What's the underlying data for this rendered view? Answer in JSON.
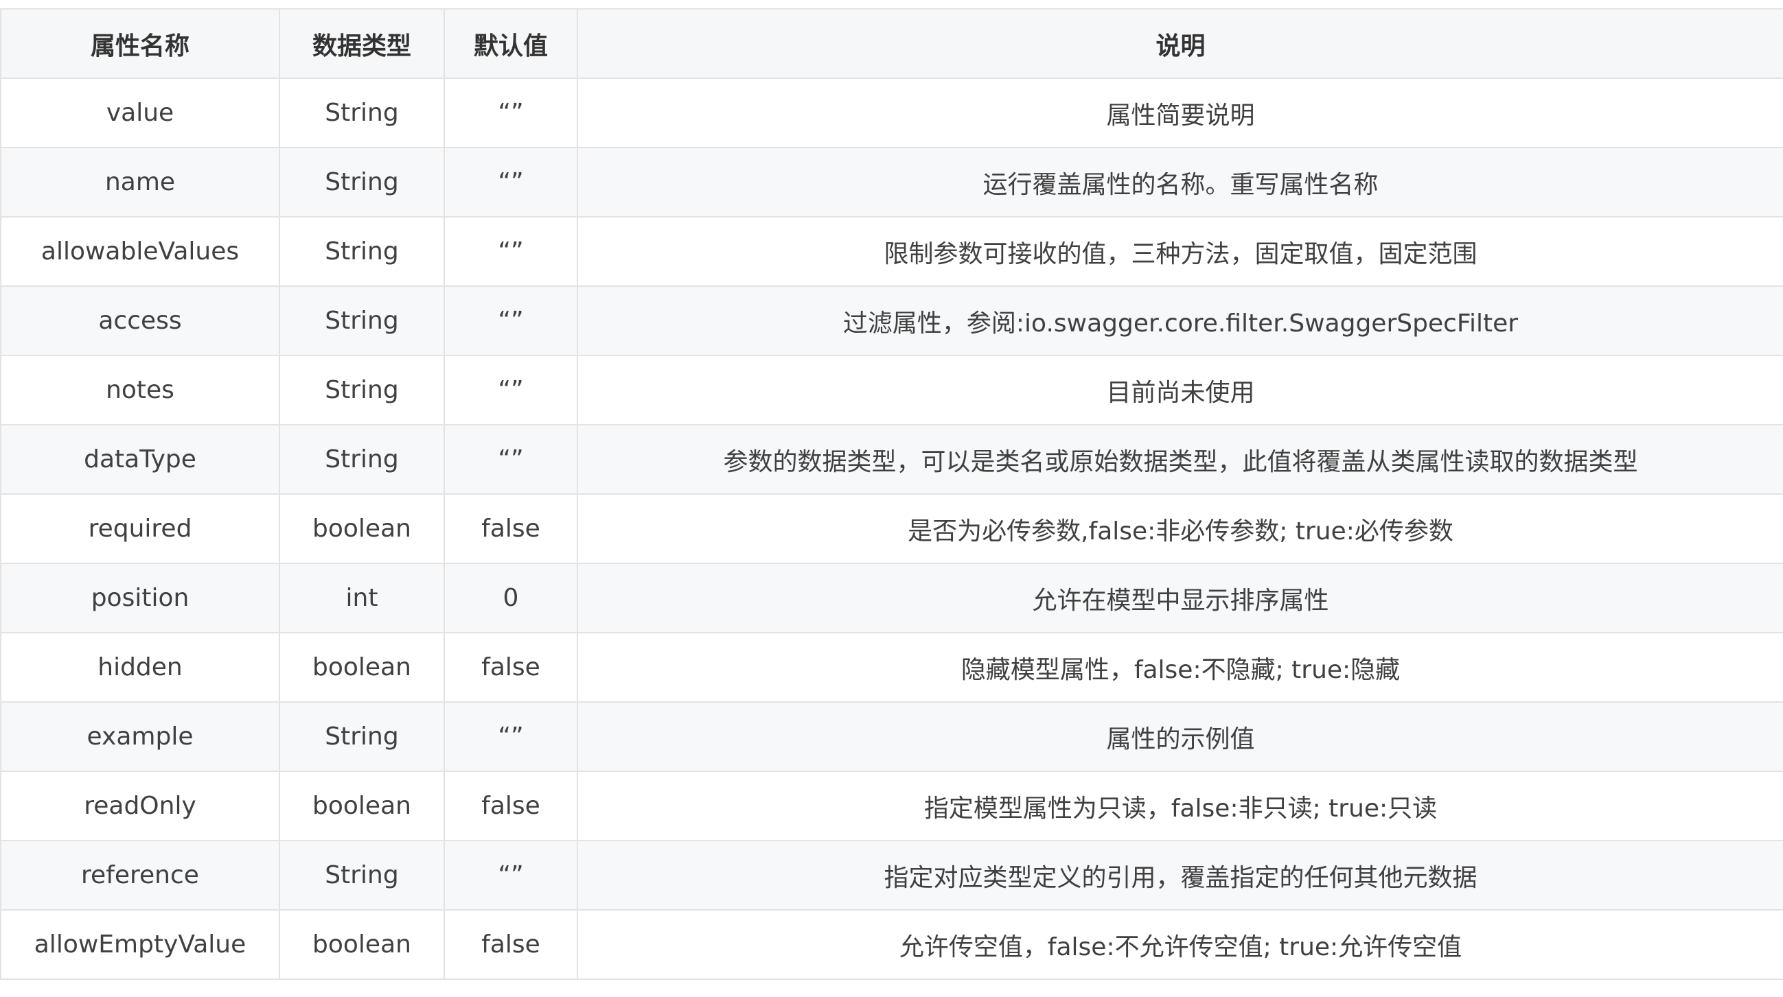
{
  "table": {
    "headers": [
      "属性名称",
      "数据类型",
      "默认值",
      "说明"
    ],
    "rows": [
      {
        "name": "value",
        "type": "String",
        "default": "“”",
        "desc": "属性简要说明"
      },
      {
        "name": "name",
        "type": "String",
        "default": "“”",
        "desc": "运行覆盖属性的名称。重写属性名称"
      },
      {
        "name": "allowableValues",
        "type": "String",
        "default": "“”",
        "desc": "限制参数可接收的值，三种方法，固定取值，固定范围"
      },
      {
        "name": "access",
        "type": "String",
        "default": "“”",
        "desc": "过滤属性，参阅:io.swagger.core.filter.SwaggerSpecFilter"
      },
      {
        "name": "notes",
        "type": "String",
        "default": "“”",
        "desc": "目前尚未使用"
      },
      {
        "name": "dataType",
        "type": "String",
        "default": "“”",
        "desc": "参数的数据类型，可以是类名或原始数据类型，此值将覆盖从类属性读取的数据类型"
      },
      {
        "name": "required",
        "type": "boolean",
        "default": "false",
        "desc": "是否为必传参数,false:非必传参数; true:必传参数"
      },
      {
        "name": "position",
        "type": "int",
        "default": "0",
        "desc": "允许在模型中显示排序属性"
      },
      {
        "name": "hidden",
        "type": "boolean",
        "default": "false",
        "desc": "隐藏模型属性，false:不隐藏; true:隐藏"
      },
      {
        "name": "example",
        "type": "String",
        "default": "“”",
        "desc": "属性的示例值"
      },
      {
        "name": "readOnly",
        "type": "boolean",
        "default": "false",
        "desc": "指定模型属性为只读，false:非只读; true:只读"
      },
      {
        "name": "reference",
        "type": "String",
        "default": "“”",
        "desc": "指定对应类型定义的引用，覆盖指定的任何其他元数据"
      },
      {
        "name": "allowEmptyValue",
        "type": "boolean",
        "default": "false",
        "desc": "允许传空值，false:不允许传空值; true:允许传空值"
      }
    ]
  }
}
